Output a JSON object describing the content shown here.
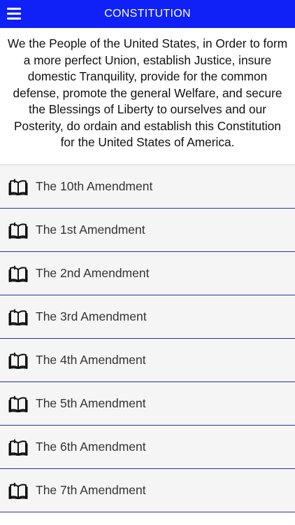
{
  "header": {
    "title": "CONSTITUTION",
    "menu_icon": "hamburger-menu-icon",
    "background_color": "#0f21f6"
  },
  "preamble": {
    "text": "We the People of the United States, in Order to form a more perfect Union, establish Justice, insure domestic Tranquility, provide for the common defense, promote the general Welfare, and secure the Blessings of Liberty to ourselves and our Posterity, do ordain and establish this Constitution for the United States of America."
  },
  "amendments": {
    "icon": "book-icon",
    "separator_color": "#2a2fa8",
    "items": [
      {
        "label": "The 10th Amendment"
      },
      {
        "label": "The 1st Amendment"
      },
      {
        "label": "The 2nd Amendment"
      },
      {
        "label": "The 3rd Amendment"
      },
      {
        "label": "The 4th Amendment"
      },
      {
        "label": "The 5th Amendment"
      },
      {
        "label": "The 6th Amendment"
      },
      {
        "label": "The 7th Amendment"
      }
    ]
  }
}
